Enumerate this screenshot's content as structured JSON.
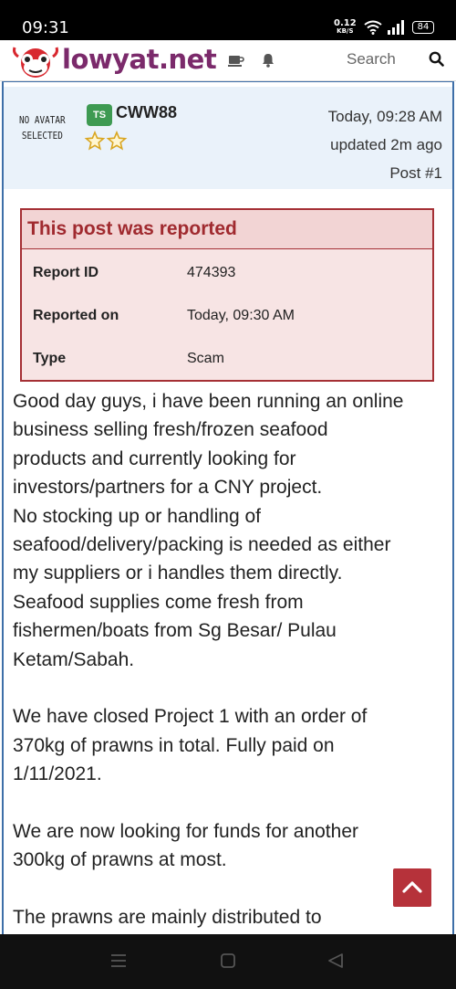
{
  "status_bar": {
    "time": "09:31",
    "net_speed": "0.12",
    "net_unit": "KB/S",
    "battery": "84"
  },
  "header": {
    "site_name": "lowyat.net",
    "search_placeholder": "Search",
    "brand_color": "#7b2a6b"
  },
  "post": {
    "avatar_text_line1": "NO AVATAR",
    "avatar_text_line2": "SELECTED",
    "badge": "TS",
    "username": "CWW88",
    "rank_stars": 2,
    "timestamp": "Today, 09:28 AM",
    "updated": "updated 2m ago",
    "post_number": "Post #1"
  },
  "report": {
    "title": "This post was reported",
    "rows": [
      {
        "label": "Report ID",
        "value": "474393"
      },
      {
        "label": "Reported on",
        "value": "Today, 09:30 AM"
      },
      {
        "label": "Type",
        "value": "Scam"
      }
    ]
  },
  "body": {
    "lines": [
      "Good day guys, i have been running an online",
      "business selling fresh/frozen seafood",
      "products and currently looking for",
      "investors/partners for a CNY project.",
      "No stocking up or handling of",
      "seafood/delivery/packing is needed as either",
      "my suppliers or i handles them directly.",
      "Seafood supplies come fresh from",
      "fishermen/boats from Sg Besar/ Pulau",
      "Ketam/Sabah.",
      "",
      "We have closed Project 1 with an order of",
      "370kg of prawns in total. Fully paid on",
      "1/11/2021.",
      "",
      "We are now looking for funds for another",
      "300kg of prawns at most.",
      "",
      "The prawns are mainly distributed to"
    ]
  },
  "colors": {
    "frame_border": "#3e6fa8",
    "report_accent": "#a53035",
    "scroll_button": "#b6323a",
    "badge_green": "#3e9a52"
  }
}
